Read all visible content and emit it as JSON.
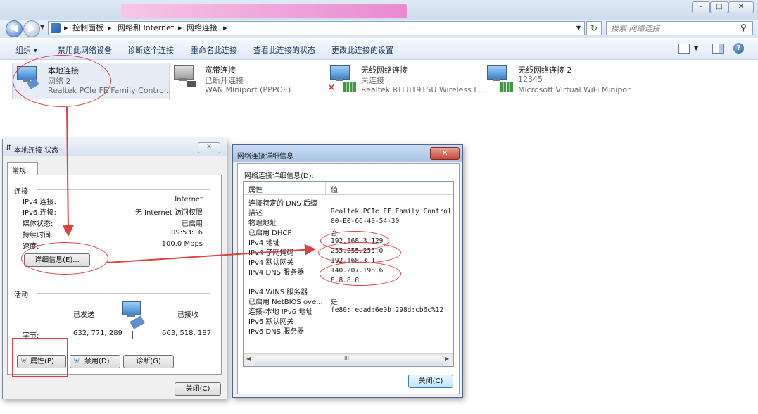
{
  "window_controls": {
    "minimize": "–",
    "maximize": "□",
    "close": "✕"
  },
  "address": {
    "crumbs": [
      "控制面板",
      "网络和 Internet",
      "网络连接"
    ],
    "search_placeholder": "搜索 网络连接"
  },
  "toolbar": {
    "items": [
      "组织 ▾",
      "禁用此网络设备",
      "诊断这个连接",
      "重命名此连接",
      "查看此连接的状态",
      "更改此连接的设置"
    ]
  },
  "connections": [
    {
      "name": "本地连接",
      "status": "网络  2",
      "device": "Realtek PCIe FE Family Control..."
    },
    {
      "name": "宽带连接",
      "status": "已断开连接",
      "device": "WAN Miniport (PPPOE)"
    },
    {
      "name": "无线网络连接",
      "status": "未连接",
      "device": "Realtek RTL8191SU Wireless L..."
    },
    {
      "name": "无线网络连接 2",
      "status": "12345",
      "device": "Microsoft Virtual WiFi Minipor..."
    }
  ],
  "status_dialog": {
    "title": "本地连接 状态",
    "tab": "常规",
    "section_connection": "连接",
    "rows": [
      {
        "label": "IPv4 连接:",
        "value": "Internet"
      },
      {
        "label": "IPv6 连接:",
        "value": "无 Internet 访问权限"
      },
      {
        "label": "媒体状态:",
        "value": "已启用"
      },
      {
        "label": "持续时间:",
        "value": "09:53:16"
      },
      {
        "label": "速度:",
        "value": "100.0 Mbps"
      }
    ],
    "details_button": "详细信息(E)...",
    "section_activity": "活动",
    "sent_label": "已发送",
    "recv_label": "已接收",
    "bytes_label": "字节:",
    "bytes_sent": "632, 771, 289",
    "bytes_recv": "663, 518, 187",
    "properties_button": "属性(P)",
    "disable_button": "禁用(D)",
    "diagnose_button": "诊断(G)",
    "close_button": "关闭(C)",
    "close_x": "✕"
  },
  "details_dialog": {
    "title": "网络连接详细信息",
    "subtitle": "网络连接详细信息(D):",
    "col_property": "属性",
    "col_value": "值",
    "rows": [
      {
        "property": "连接特定的 DNS 后缀",
        "value": ""
      },
      {
        "property": "描述",
        "value": "Realtek PCIe FE Family Controller"
      },
      {
        "property": "物理地址",
        "value": "00-E0-66-40-54-30"
      },
      {
        "property": "已启用 DHCP",
        "value": "否"
      },
      {
        "property": "IPv4 地址",
        "value": "192.168.3.129"
      },
      {
        "property": "IPv4 子网掩码",
        "value": "255.255.255.0"
      },
      {
        "property": "IPv4 默认网关",
        "value": "192.168.3.1"
      },
      {
        "property": "IPv4 DNS 服务器",
        "value": "140.207.198.6"
      },
      {
        "property": "",
        "value": "8.8.8.8"
      },
      {
        "property": "IPv4 WINS 服务器",
        "value": ""
      },
      {
        "property": "已启用 NetBIOS ove...",
        "value": "是"
      },
      {
        "property": "连接-本地 IPv6 地址",
        "value": "fe80::edad:6e0b:298d:cb6c%12"
      },
      {
        "property": "IPv6 默认网关",
        "value": ""
      },
      {
        "property": "IPv6 DNS 服务器",
        "value": ""
      }
    ],
    "scroll_grip": "III",
    "close_button": "关闭(C)",
    "close_x": "✕"
  },
  "colors": {
    "annotation_red": "#e0403f",
    "title_gradient_top": "#eef3fa",
    "accent_blue": "#3b6cb0"
  }
}
